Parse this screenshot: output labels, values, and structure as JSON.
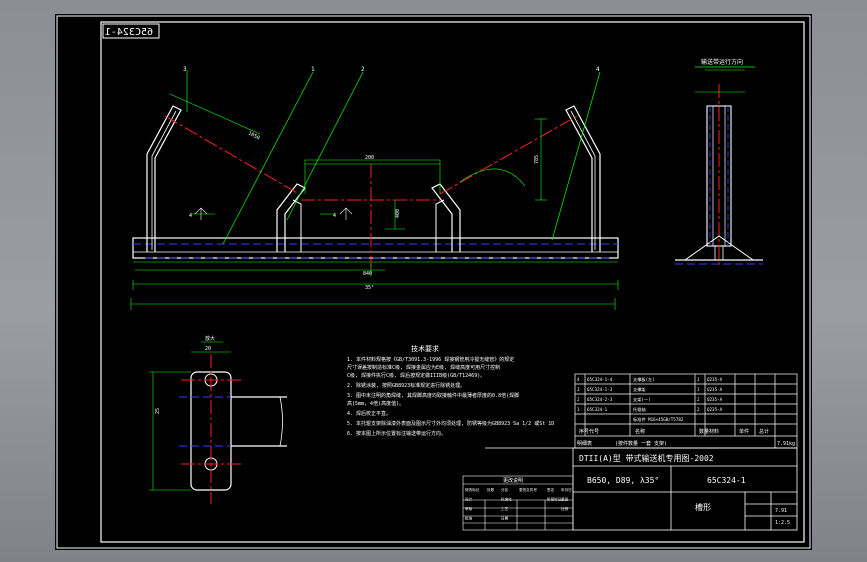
{
  "drawing": {
    "stamp_mirrored": "65C324-1",
    "side_view_title": "输送带运行方向",
    "detail_label": "放大",
    "notes": {
      "title": "技术要求",
      "items": [
        "1. 本件材料规格按《GB/T3091.3-1996 焊接钢管用冷拔无缝管》的规定",
        "   尺寸误差按制造标准C级, 焊接金属应为E级, 焊缝高度可用尺寸控制",
        "   C级, 焊接件执行C级, 焊后按规定做IIIB级(GB/T12469)。",
        "2. 除锈涂装, 按照GB8923标准规定进行除锈处理。",
        "3. 图中未注明的角焊缝, 其焊脚高度均取接触件中最薄者厚度的0.8倍(焊脚",
        "   高)5mm, 4倍(高度值)。",
        "4. 焊后校正平直。",
        "5. 本托辊支架除油漆外表面及图示尺寸外均须处理, 防锈等级为GB8923 Sa 1/2 或St 1D",
        "6. 按本图上所示位置标注输送带运行方向。"
      ]
    },
    "parts_table": {
      "rows": [
        [
          "4",
          "65C324-1-4",
          "支撑板(左)",
          "1",
          "Q235-A",
          "",
          ""
        ],
        [
          "3",
          "65C324-1-3",
          "支撑架",
          "1",
          "Q235-A",
          "",
          ""
        ],
        [
          "2",
          "65C324-2-3",
          "支架(一)",
          "2",
          "Q235-A",
          "",
          ""
        ],
        [
          "1",
          "65C324-1",
          "托辊轴",
          "2",
          "Q235-A",
          "",
          ""
        ],
        [
          "",
          "",
          "标准件 M16×45GB/T5782",
          "",
          "",
          "",
          ""
        ]
      ],
      "header": [
        "序号",
        "代号",
        "名称",
        "数量",
        "材料",
        "单件",
        "总计"
      ],
      "mass_row": [
        "明细表",
        "(按件数量 一套 支架)",
        "",
        "7.91kg"
      ]
    },
    "title_block": {
      "main_title": "DTII(A)型  带式输送机专用图-2002",
      "spec": "B650, D89, λ35°",
      "code": "65C324-1",
      "name": "槽形",
      "scale": "1:2.5",
      "mass": "7.91"
    },
    "revision_table": {
      "title": "更改说明",
      "rows": [
        [
          "修改标记",
          "处数",
          "分区",
          "更改文件号",
          "签名",
          "年月日"
        ],
        [
          "设计",
          "",
          "标准化",
          "",
          "阶段标记",
          "重量"
        ],
        [
          "审核",
          "",
          "工艺",
          "",
          "",
          "比例"
        ],
        [
          "批准",
          "",
          "日期",
          "",
          "",
          ""
        ]
      ]
    },
    "dimensions": {
      "d_1050": "1050",
      "d_200": "200",
      "d_400": "400",
      "d_840": "840",
      "d_785": "785",
      "d_35": "35°",
      "d_25": "25",
      "d_20": "20"
    },
    "leader_numbers": [
      "3",
      "1",
      "2",
      "4"
    ]
  }
}
